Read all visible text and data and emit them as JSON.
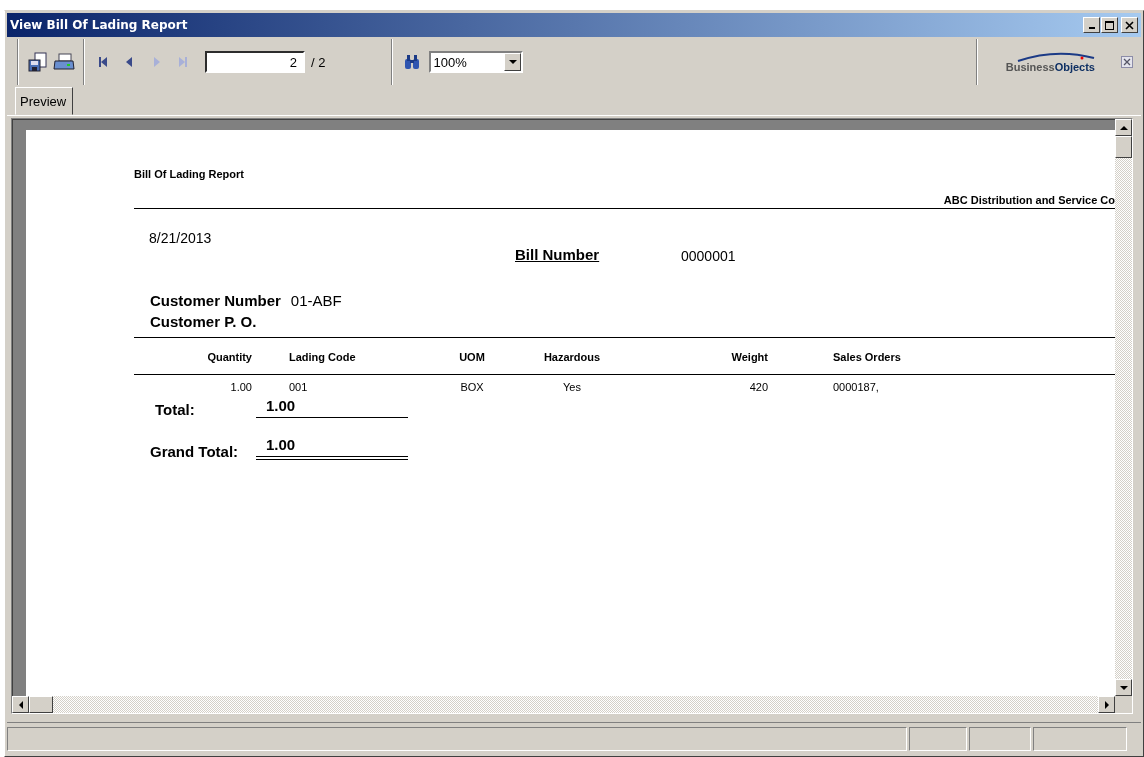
{
  "window": {
    "title": "View Bill Of Lading Report"
  },
  "toolbar": {
    "nav_buttons": [
      {
        "kind": "first",
        "disabled": false
      },
      {
        "kind": "previous",
        "disabled": false
      },
      {
        "kind": "next",
        "disabled": true
      },
      {
        "kind": "last",
        "disabled": true
      }
    ],
    "page_field": {
      "value": "2"
    },
    "page_total": "/ 2",
    "zoom": {
      "value": "100%"
    },
    "logo": {
      "parts": [
        "Business",
        "Objects"
      ]
    }
  },
  "tabs": [
    {
      "label": "Preview",
      "selected": true
    }
  ],
  "report": {
    "title": "Bill Of Lading Report",
    "company": "ABC Distribution and Service Co",
    "date": "8/21/2013",
    "bill_number": {
      "label": "Bill Number",
      "value": "0000001"
    },
    "customer_number": {
      "label": "Customer Number",
      "value": "01-ABF"
    },
    "customer_po": {
      "label": "Customer P. O."
    },
    "columns": [
      "Quantity",
      "Lading Code",
      "UOM",
      "Hazardous",
      "Weight",
      "Sales Orders"
    ],
    "rows": [
      [
        "1.00",
        "001",
        "BOX",
        "Yes",
        "420",
        "0000187,"
      ]
    ],
    "total": {
      "label": "Total:",
      "value": "1.00"
    },
    "grand_total": {
      "label": "Grand Total:",
      "value": "1.00"
    }
  }
}
